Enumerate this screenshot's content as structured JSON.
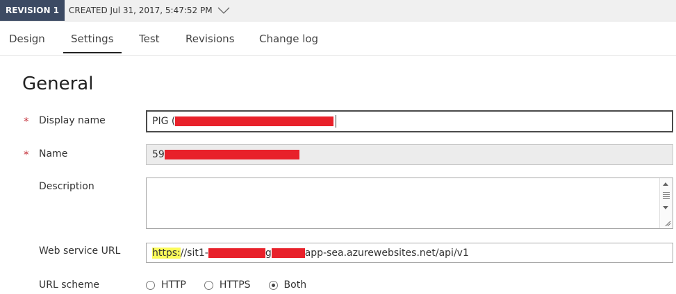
{
  "revision": {
    "badge": "REVISION 1",
    "created": "CREATED Jul 31, 2017, 5:47:52 PM"
  },
  "tabs": [
    {
      "label": "Design",
      "active": false
    },
    {
      "label": "Settings",
      "active": true
    },
    {
      "label": "Test",
      "active": false
    },
    {
      "label": "Revisions",
      "active": false
    },
    {
      "label": "Change log",
      "active": false
    }
  ],
  "section": {
    "title": "General"
  },
  "form": {
    "required_mark": "*",
    "display_name": {
      "label": "Display name",
      "value_visible": "PIG ("
    },
    "name": {
      "label": "Name",
      "value_visible": "59"
    },
    "description": {
      "label": "Description",
      "value": ""
    },
    "web_service_url": {
      "label": "Web service URL",
      "scheme_part": "https:",
      "part_before_redaction": "//sit1-",
      "part_mid": "g",
      "part_after_redaction": "app-sea.azurewebsites.net/api/v1"
    },
    "url_scheme": {
      "label": "URL scheme",
      "options": [
        "HTTP",
        "HTTPS",
        "Both"
      ],
      "selected": "Both"
    }
  },
  "colors": {
    "badge_bg": "#3c4a63",
    "redaction": "#e8212a",
    "highlight": "#fbfb5a",
    "required": "#c4303a"
  }
}
